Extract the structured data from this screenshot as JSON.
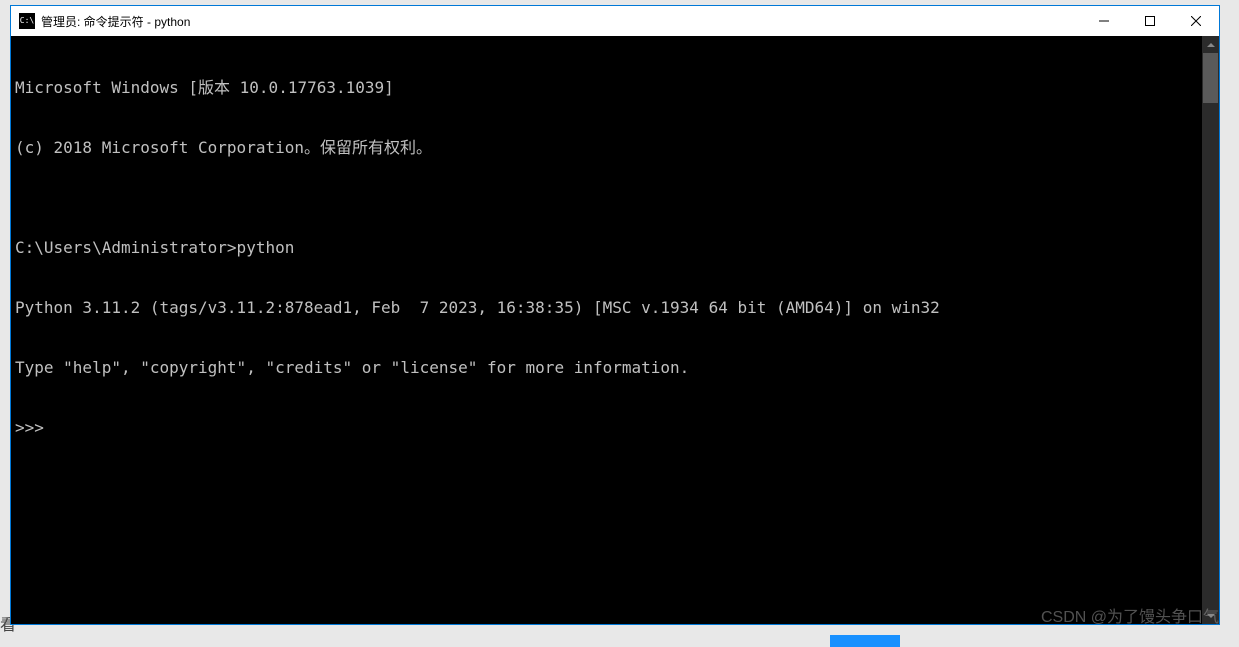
{
  "window": {
    "title": "管理员: 命令提示符 - python",
    "icon_label": "C:\\"
  },
  "terminal": {
    "lines": [
      "Microsoft Windows [版本 10.0.17763.1039]",
      "(c) 2018 Microsoft Corporation。保留所有权利。",
      "",
      "C:\\Users\\Administrator>python",
      "Python 3.11.2 (tags/v3.11.2:878ead1, Feb  7 2023, 16:38:35) [MSC v.1934 64 bit (AMD64)] on win32",
      "Type \"help\", \"copyright\", \"credits\" or \"license\" for more information.",
      ">>> "
    ]
  },
  "watermark": "CSDN @为了馒头争口气",
  "bg_fragment_left": "看"
}
